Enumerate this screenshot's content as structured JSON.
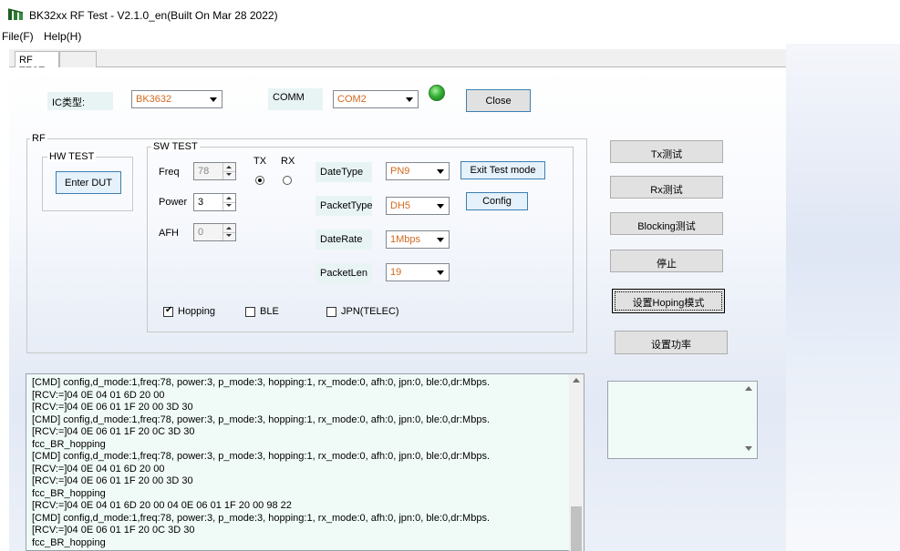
{
  "window": {
    "title": "BK32xx RF Test - V2.1.0_en(Built On Mar 28 2022)"
  },
  "menu": [
    {
      "label": "File(F)"
    },
    {
      "label": "Help(H)"
    }
  ],
  "tabs": [
    {
      "label": "RF TEST"
    },
    {
      "label": ""
    }
  ],
  "top": {
    "ic_label": "IC类型:",
    "ic_value": "BK3632",
    "comm_label": "COMM",
    "comm_value": "COM2",
    "close_label": "Close"
  },
  "rf": {
    "group_label": "RF",
    "hw_test": {
      "title": "HW TEST",
      "enter_dut": "Enter DUT"
    },
    "sw_test": {
      "title": "SW TEST",
      "freq_label": "Freq",
      "freq_value": "78",
      "power_label": "Power",
      "power_value": "3",
      "afh_label": "AFH",
      "afh_value": "0",
      "tx_label": "TX",
      "rx_label": "RX",
      "tx_selected": true,
      "datetype_label": "DateType",
      "datetype_value": "PN9",
      "packettype_label": "PacketType",
      "packettype_value": "DH5",
      "daterate_label": "DateRate",
      "daterate_value": "1Mbps",
      "packetlen_label": "PacketLen",
      "packetlen_value": "19",
      "exit_test_mode": "Exit Test mode",
      "config": "Config",
      "hopping_label": "Hopping",
      "hopping_checked": true,
      "ble_label": "BLE",
      "ble_checked": false,
      "jpn_label": "JPN(TELEC)",
      "jpn_checked": false
    }
  },
  "side_buttons": [
    {
      "label": "Tx测试"
    },
    {
      "label": "Rx测试"
    },
    {
      "label": "Blocking测试"
    },
    {
      "label": "停止"
    },
    {
      "label": "设置Hoping模式"
    },
    {
      "label": "设置功率"
    }
  ],
  "log": [
    "[CMD] config,d_mode:1,freq:78, power:3, p_mode:3, hopping:1, rx_mode:0, afh:0, jpn:0, ble:0,dr:Mbps.",
    "[RCV:=]04 0E 04 01 6D 20 00",
    "[RCV:=]04 0E 06 01 1F 20 00 3D 30",
    "[CMD] config,d_mode:1,freq:78, power:3, p_mode:3, hopping:1, rx_mode:0, afh:0, jpn:0, ble:0,dr:Mbps.",
    "[RCV:=]04 0E 06 01 1F 20 0C 3D 30",
    "fcc_BR_hopping",
    "[CMD] config,d_mode:1,freq:78, power:3, p_mode:3, hopping:1, rx_mode:0, afh:0, jpn:0, ble:0,dr:Mbps.",
    "[RCV:=]04 0E 04 01 6D 20 00",
    "[RCV:=]04 0E 06 01 1F 20 00 3D 30",
    "fcc_BR_hopping",
    "[RCV:=]04 0E 04 01 6D 20 00 04 0E 06 01 1F 20 00 98 22",
    "[CMD] config,d_mode:1,freq:78, power:3, p_mode:3, hopping:1, rx_mode:0, afh:0, jpn:0, ble:0,dr:Mbps.",
    "[RCV:=]04 0E 06 01 1F 20 0C 3D 30",
    "fcc_BR_hopping"
  ],
  "colors": {
    "accent_value": "#d2691e",
    "led": "#36b336",
    "log_bg": "#f0fbf8"
  }
}
